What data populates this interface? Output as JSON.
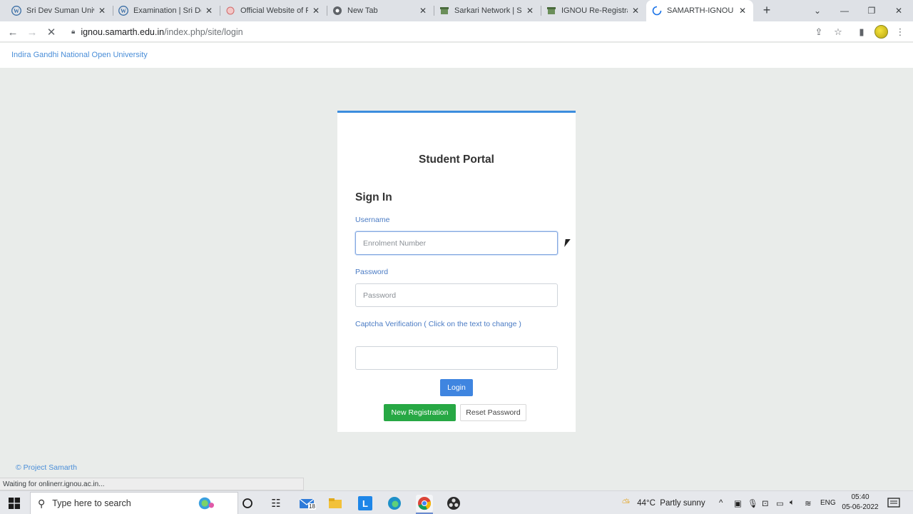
{
  "browser": {
    "tabs": [
      {
        "title": "Sri Dev Suman Univer",
        "favicon": "wordpress-icon",
        "active": false
      },
      {
        "title": "Examination | Sri Dev",
        "favicon": "wordpress-icon",
        "active": false
      },
      {
        "title": "Official Website of Pa",
        "favicon": "emblem-icon",
        "active": false
      },
      {
        "title": "New Tab",
        "favicon": "chrome-icon",
        "active": false
      },
      {
        "title": "Sarkari Network | Sark",
        "favicon": "site-icon",
        "active": false
      },
      {
        "title": "IGNOU Re-Registratio",
        "favicon": "site-icon",
        "active": false
      },
      {
        "title": "SAMARTH-IGNOU",
        "favicon": "loading-spinner-icon",
        "active": true
      }
    ],
    "url_domain": "ignou.samarth.edu.in",
    "url_path": "/index.php/site/login",
    "status_text": "Waiting for onlinerr.ignou.ac.in..."
  },
  "page": {
    "university_name": "Indira Gandhi National Open University",
    "portal_title": "Student Portal",
    "sign_in_heading": "Sign In",
    "username_label": "Username",
    "username_placeholder": "Enrolment Number",
    "password_label": "Password",
    "password_placeholder": "Password",
    "captcha_label": "Captcha Verification ( Click on the text to change )",
    "login_button": "Login",
    "new_registration_button": "New Registration",
    "reset_password_button": "Reset Password",
    "footer_text": "© Project Samarth"
  },
  "taskbar": {
    "search_placeholder": "Type here to search",
    "mail_badge": "18",
    "weather": "44°C  Partly sunny",
    "language": "ENG",
    "time": "05:40",
    "date": "05-06-2022"
  },
  "colors": {
    "accent_blue": "#3f85e0",
    "success_green": "#27a844",
    "link_blue": "#4a8ed8",
    "page_bg": "#e9ecea"
  }
}
